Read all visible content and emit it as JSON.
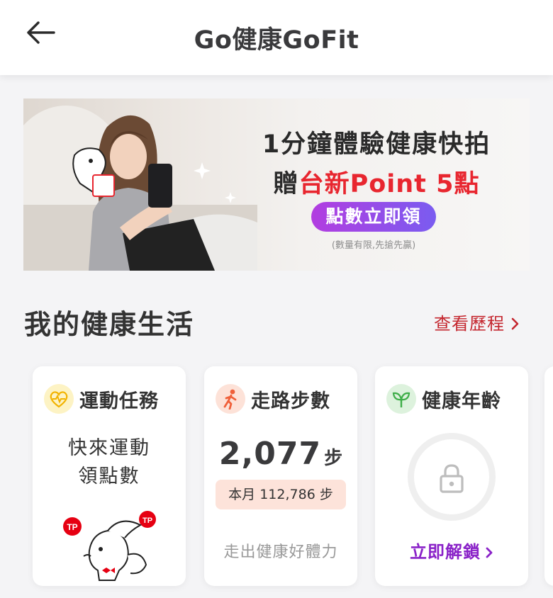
{
  "header": {
    "title": "Go健康GoFit",
    "back_icon": "arrow-left-icon"
  },
  "banner": {
    "line1": "1分鐘體驗健康快拍",
    "line2_prefix": "贈",
    "line2_highlight": "台新Point 5點",
    "cta": "點數立即領",
    "note": "(數量有限,先搶先贏)",
    "colors": {
      "highlight": "#e8262f",
      "cta_start": "#b23de0",
      "cta_end": "#7a5cf0"
    }
  },
  "section": {
    "title": "我的健康生活",
    "link": "查看歷程"
  },
  "cards": {
    "exercise": {
      "title": "運動任務",
      "line1": "快來運動",
      "line2": "領點數",
      "icon": "heart-pulse-icon",
      "mascot_badge": "TP"
    },
    "steps": {
      "title": "走路步數",
      "count": "2,077",
      "unit": "步",
      "month": "本月 112,786 步",
      "footer": "走出健康好體力",
      "icon": "walking-person-icon"
    },
    "age": {
      "title": "健康年齡",
      "action": "立即解鎖",
      "icon": "sprout-icon",
      "lock_icon": "lock-icon"
    }
  }
}
